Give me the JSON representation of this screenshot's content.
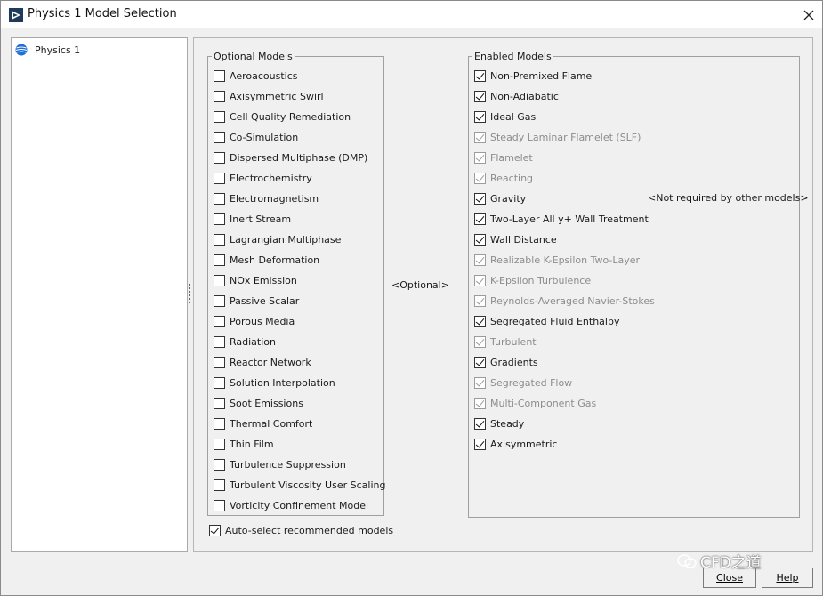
{
  "window": {
    "title": "Physics 1 Model Selection"
  },
  "tree": {
    "items": [
      {
        "label": "Physics 1",
        "icon": "physics-continuum-icon"
      }
    ]
  },
  "optional": {
    "legend": "Optional Models",
    "hint": "<Optional>",
    "items": [
      {
        "label": "Aeroacoustics",
        "checked": false
      },
      {
        "label": "Axisymmetric Swirl",
        "checked": false
      },
      {
        "label": "Cell Quality Remediation",
        "checked": false
      },
      {
        "label": "Co-Simulation",
        "checked": false
      },
      {
        "label": "Dispersed Multiphase (DMP)",
        "checked": false
      },
      {
        "label": "Electrochemistry",
        "checked": false
      },
      {
        "label": "Electromagnetism",
        "checked": false
      },
      {
        "label": "Inert Stream",
        "checked": false
      },
      {
        "label": "Lagrangian Multiphase",
        "checked": false
      },
      {
        "label": "Mesh Deformation",
        "checked": false
      },
      {
        "label": "NOx Emission",
        "checked": false
      },
      {
        "label": "Passive Scalar",
        "checked": false
      },
      {
        "label": "Porous Media",
        "checked": false
      },
      {
        "label": "Radiation",
        "checked": false
      },
      {
        "label": "Reactor Network",
        "checked": false
      },
      {
        "label": "Solution Interpolation",
        "checked": false
      },
      {
        "label": "Soot Emissions",
        "checked": false
      },
      {
        "label": "Thermal Comfort",
        "checked": false
      },
      {
        "label": "Thin Film",
        "checked": false
      },
      {
        "label": "Turbulence Suppression",
        "checked": false
      },
      {
        "label": "Turbulent Viscosity User Scaling",
        "checked": false
      },
      {
        "label": "Vorticity Confinement Model",
        "checked": false
      }
    ]
  },
  "enabled": {
    "legend": "Enabled Models",
    "note": "<Not required by other models>",
    "items": [
      {
        "label": "Non-Premixed Flame",
        "checked": true,
        "disabled": false
      },
      {
        "label": "Non-Adiabatic",
        "checked": true,
        "disabled": false
      },
      {
        "label": "Ideal Gas",
        "checked": true,
        "disabled": false
      },
      {
        "label": "Steady Laminar Flamelet (SLF)",
        "checked": true,
        "disabled": true
      },
      {
        "label": "Flamelet",
        "checked": true,
        "disabled": true
      },
      {
        "label": "Reacting",
        "checked": true,
        "disabled": true
      },
      {
        "label": "Gravity",
        "checked": true,
        "disabled": false
      },
      {
        "label": "Two-Layer All y+ Wall Treatment",
        "checked": true,
        "disabled": false
      },
      {
        "label": "Wall Distance",
        "checked": true,
        "disabled": false
      },
      {
        "label": "Realizable K-Epsilon Two-Layer",
        "checked": true,
        "disabled": true
      },
      {
        "label": "K-Epsilon Turbulence",
        "checked": true,
        "disabled": true
      },
      {
        "label": "Reynolds-Averaged Navier-Stokes",
        "checked": true,
        "disabled": true
      },
      {
        "label": "Segregated Fluid Enthalpy",
        "checked": true,
        "disabled": false
      },
      {
        "label": "Turbulent",
        "checked": true,
        "disabled": true
      },
      {
        "label": "Gradients",
        "checked": true,
        "disabled": false
      },
      {
        "label": "Segregated Flow",
        "checked": true,
        "disabled": true
      },
      {
        "label": "Multi-Component Gas",
        "checked": true,
        "disabled": true
      },
      {
        "label": "Steady",
        "checked": true,
        "disabled": false
      },
      {
        "label": "Axisymmetric",
        "checked": true,
        "disabled": false
      }
    ]
  },
  "auto_select": {
    "label": "Auto-select recommended models",
    "checked": true
  },
  "buttons": {
    "close": "Close",
    "help": "Help"
  },
  "watermark": {
    "text": "CFD之道"
  },
  "colors": {
    "disabled_text": "#8c8c8c",
    "tree_icon": "#1f6fd6"
  }
}
